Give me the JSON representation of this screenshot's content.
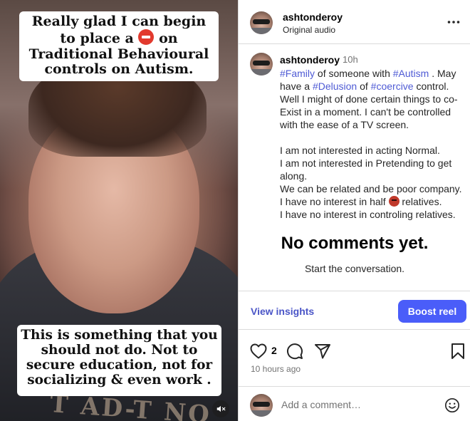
{
  "media": {
    "caption_top_part1": "Really glad I can begin to place a",
    "caption_top_part2": "on Traditional Behavioural controls on Autism.",
    "caption_bottom": "This is something that you should not do.  Not to secure education, not for socializing & even work .",
    "shirt_print": "T AD-T NO",
    "stop_emoji": "stop-sign-emoji",
    "mute_icon": "speaker-muted-icon"
  },
  "header": {
    "username": "ashtonderoy",
    "audio": "Original audio",
    "more_icon": "more-horizontal-icon"
  },
  "post": {
    "username": "ashtonderoy",
    "age": "10h",
    "tag_family": "#Family",
    "t1": " of someone with ",
    "tag_autism": "#Autism",
    "t2": " . May have a ",
    "tag_delusion": "#Delusion",
    "t3": " of ",
    "tag_coercive": "#coercive",
    "t4": " control. Well I might of done certain things to co-Exist in a moment. I can't be controlled with the ease of a TV screen.",
    "line_normal": "I am not interested in acting Normal.",
    "line_pretending": "I am not interested in Pretending to get along.",
    "line_related": "We can be related and be poor company.",
    "line_half_a": "I have no interest in half",
    "line_half_b": " relatives.",
    "line_controling": "I have no interest in controling relatives.",
    "demon_emoji": "angry-demon-emoji"
  },
  "comments": {
    "empty_title": "No comments yet.",
    "empty_sub": "Start the conversation."
  },
  "insights": {
    "view_label": "View insights",
    "boost_label": "Boost reel"
  },
  "actions": {
    "like_count": "2",
    "timestamp": "10 hours ago",
    "icons": [
      "heart-icon",
      "comment-icon",
      "share-icon",
      "bookmark-icon"
    ]
  },
  "composer": {
    "placeholder": "Add a comment…",
    "emoji_icon": "smiley-icon"
  }
}
